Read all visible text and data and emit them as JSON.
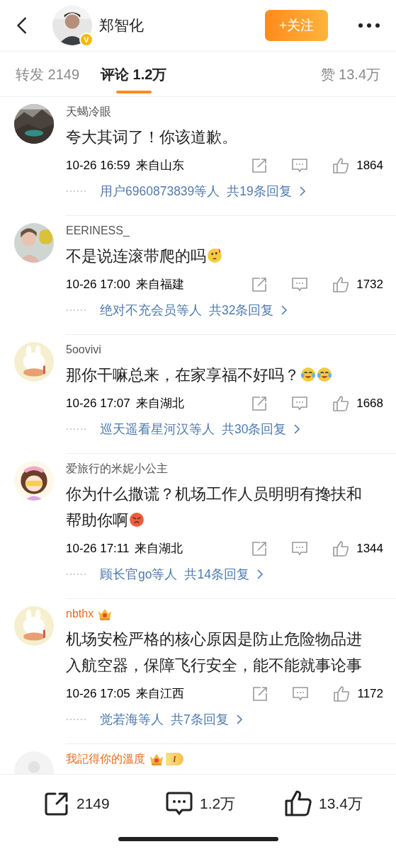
{
  "header": {
    "user_name": "郑智化",
    "verified_badge": "V",
    "follow_button": "+关注"
  },
  "tabs": [
    {
      "label": "转发 2149",
      "selected": false
    },
    {
      "label": "评论 1.2万",
      "selected": true
    },
    {
      "label": "赞 13.4万",
      "selected": false
    }
  ],
  "comments": [
    {
      "name": "天蝎冷眼",
      "vip": false,
      "text": "夸大其词了！你该道歉。",
      "time": "10-26 16:59",
      "location": "来自山东",
      "likes": "1864",
      "reply_users": "用户6960873839等人",
      "reply_count": "共19条回复"
    },
    {
      "name": "EERINESS_",
      "vip": false,
      "text": "不是说连滚带爬的吗",
      "emojis": [
        {
          "kind": "thinking"
        }
      ],
      "time": "10-26 17:00",
      "location": "来自福建",
      "likes": "1732",
      "reply_users": "绝对不充会员等人",
      "reply_count": "共32条回复"
    },
    {
      "name": "5oovivi",
      "vip": false,
      "text": "那你干嘛总来，在家享福不好吗？",
      "emojis": [
        {
          "kind": "crying-laughing"
        },
        {
          "kind": "crying-laughing"
        }
      ],
      "time": "10-26 17:07",
      "location": "来自湖北",
      "likes": "1668",
      "reply_users": "巡天遥看星河汉等人",
      "reply_count": "共30条回复"
    },
    {
      "name": "爱旅行的米妮小公主",
      "vip": false,
      "text": "你为什么撒谎？机场工作人员明明有搀扶和帮助你啊",
      "emojis": [
        {
          "kind": "angry"
        }
      ],
      "time": "10-26 17:11",
      "location": "来自湖北",
      "likes": "1344",
      "reply_users": "顾长官go等人",
      "reply_count": "共14条回复"
    },
    {
      "name": "nbthx",
      "vip": true,
      "crown": true,
      "text": "机场安检严格的核心原因是防止危险物品进入航空器，保障飞行安全，能不能就事论事",
      "time": "10-26 17:05",
      "location": "来自江西",
      "likes": "1172",
      "reply_users": "觉若海等人",
      "reply_count": "共7条回复"
    },
    {
      "name": "我記得你的溫度",
      "vip": true,
      "crown": true,
      "level_badge": "I"
    }
  ],
  "bottom_bar": {
    "reposts": "2149",
    "comments": "1.2万",
    "likes": "13.4万"
  }
}
